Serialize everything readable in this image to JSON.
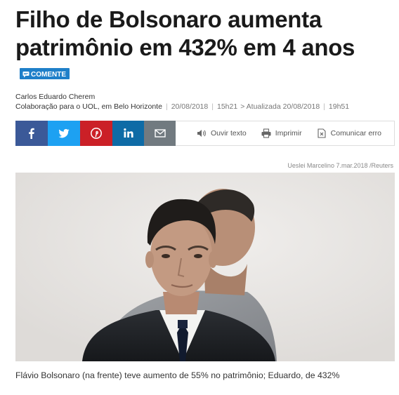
{
  "article": {
    "headline": "Filho de Bolsonaro aumenta patrimônio em 432% em 4 anos",
    "comment_label": "COMENTE",
    "author_name": "Carlos Eduardo Cherem",
    "author_role": "Colaboração para o UOL, em Belo Horizonte",
    "date": "20/08/2018",
    "time": "15h21",
    "updated": "> Atualizada 20/08/2018",
    "updated_time": "19h51"
  },
  "share": {
    "buttons": [
      {
        "name": "facebook",
        "color": "#3b5998"
      },
      {
        "name": "twitter",
        "color": "#1da1f2"
      },
      {
        "name": "pinterest",
        "color": "#cb2027"
      },
      {
        "name": "linkedin",
        "color": "#0e6ba6"
      },
      {
        "name": "email",
        "color": "#717a80"
      }
    ],
    "listen_label": "Ouvir texto",
    "print_label": "Imprimir",
    "report_label": "Comunicar erro"
  },
  "photo": {
    "credit": "Ueslei Marcelino 7.mar.2018 /Reuters",
    "caption": "Flávio Bolsonaro (na frente) teve aumento de 55% no patrimônio; Eduardo, de 432%"
  }
}
